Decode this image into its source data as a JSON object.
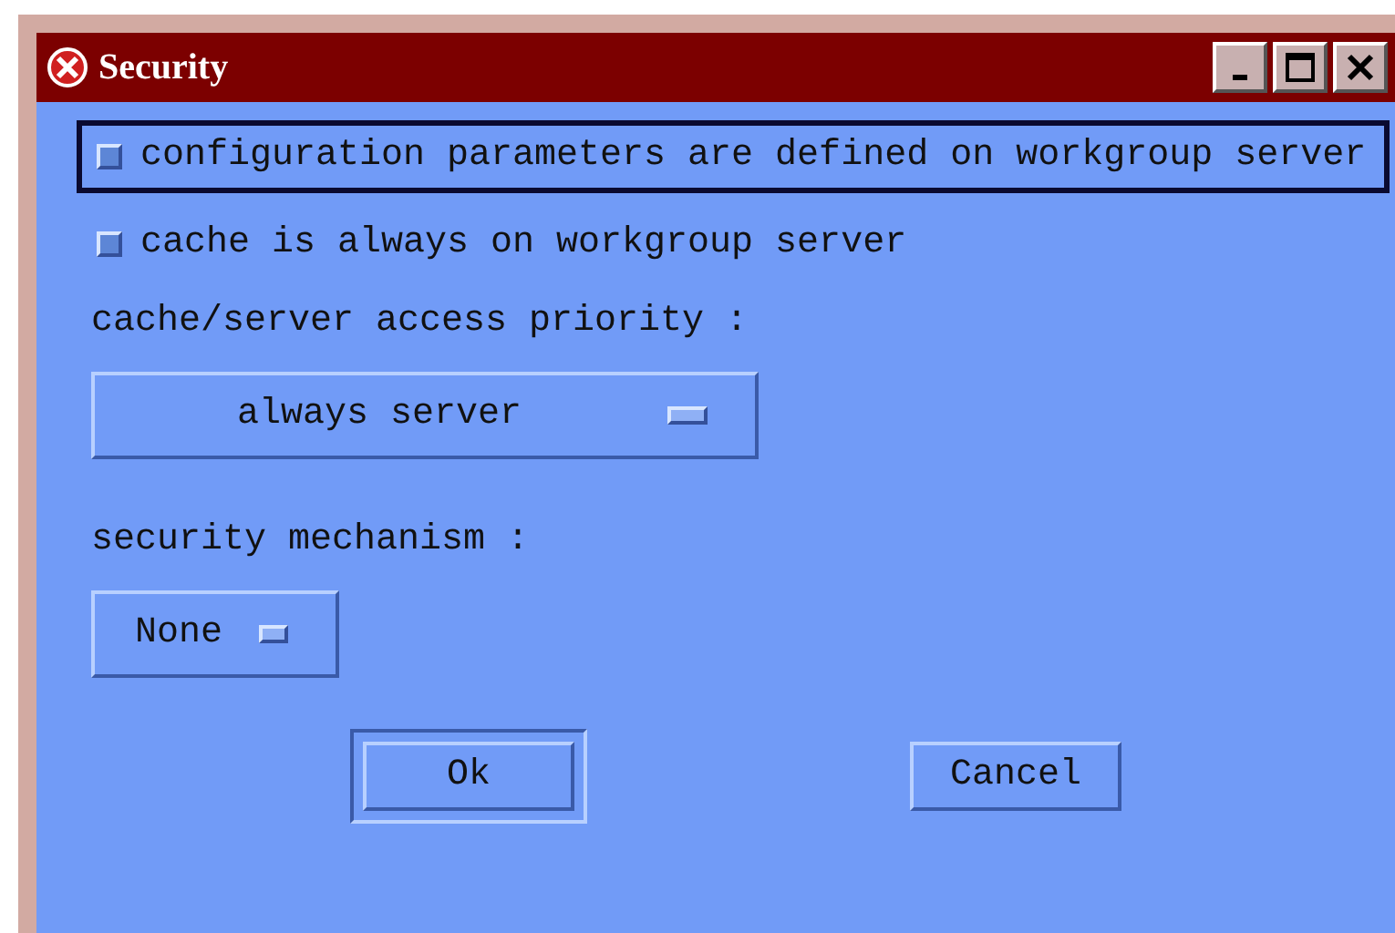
{
  "window": {
    "title": "Security"
  },
  "checkboxes": [
    {
      "label": "configuration parameters are defined on workgroup server",
      "checked": false,
      "focused": true
    },
    {
      "label": "cache is always on workgroup server",
      "checked": false,
      "focused": false
    }
  ],
  "fields": [
    {
      "label": "cache/server access priority :",
      "value": "always server"
    },
    {
      "label": "security mechanism :",
      "value": "None"
    }
  ],
  "buttons": [
    {
      "label": "Ok",
      "default": true
    },
    {
      "label": "Cancel",
      "default": false
    }
  ]
}
